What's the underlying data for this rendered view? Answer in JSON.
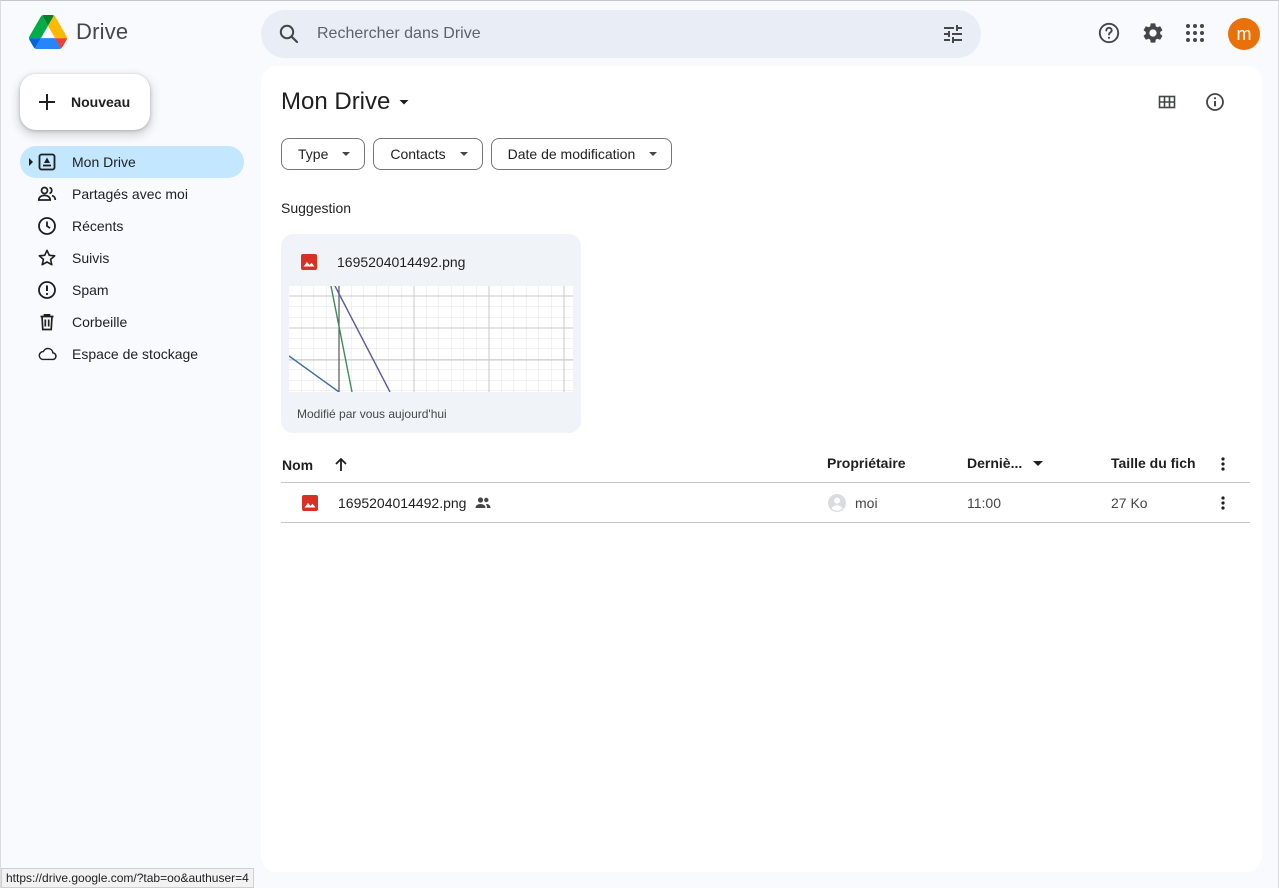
{
  "header": {
    "app_name": "Drive",
    "search_placeholder": "Rechercher dans Drive",
    "avatar_letter": "m"
  },
  "sidebar": {
    "new_button": "Nouveau",
    "items": [
      {
        "label": "Mon Drive",
        "icon": "my-drive-icon",
        "active": true
      },
      {
        "label": "Partagés avec moi",
        "icon": "shared-people-icon"
      },
      {
        "label": "Récents",
        "icon": "clock-icon"
      },
      {
        "label": "Suivis",
        "icon": "star-icon"
      },
      {
        "label": "Spam",
        "icon": "spam-icon"
      },
      {
        "label": "Corbeille",
        "icon": "trash-icon"
      },
      {
        "label": "Espace de stockage",
        "icon": "cloud-icon"
      }
    ]
  },
  "main": {
    "title": "Mon Drive",
    "filters": [
      "Type",
      "Contacts",
      "Date de modification"
    ],
    "suggestion_label": "Suggestion",
    "suggestion_card": {
      "file_name": "1695204014492.png",
      "subtitle": "Modifié par vous aujourd'hui"
    },
    "table": {
      "columns": [
        "Nom",
        "Propriétaire",
        "Derniè...",
        "Taille du fich"
      ],
      "rows": [
        {
          "name": "1695204014492.png",
          "owner": "moi",
          "modified": "11:00",
          "size": "27 Ko"
        }
      ]
    }
  },
  "status_bar": {
    "url": "https://drive.google.com/?tab=oo&authuser=4"
  },
  "colors": {
    "accent_active": "#c2e7ff",
    "search_bg": "#e9eef6",
    "image_file_red": "#d93025",
    "avatar": "#e8710a"
  }
}
